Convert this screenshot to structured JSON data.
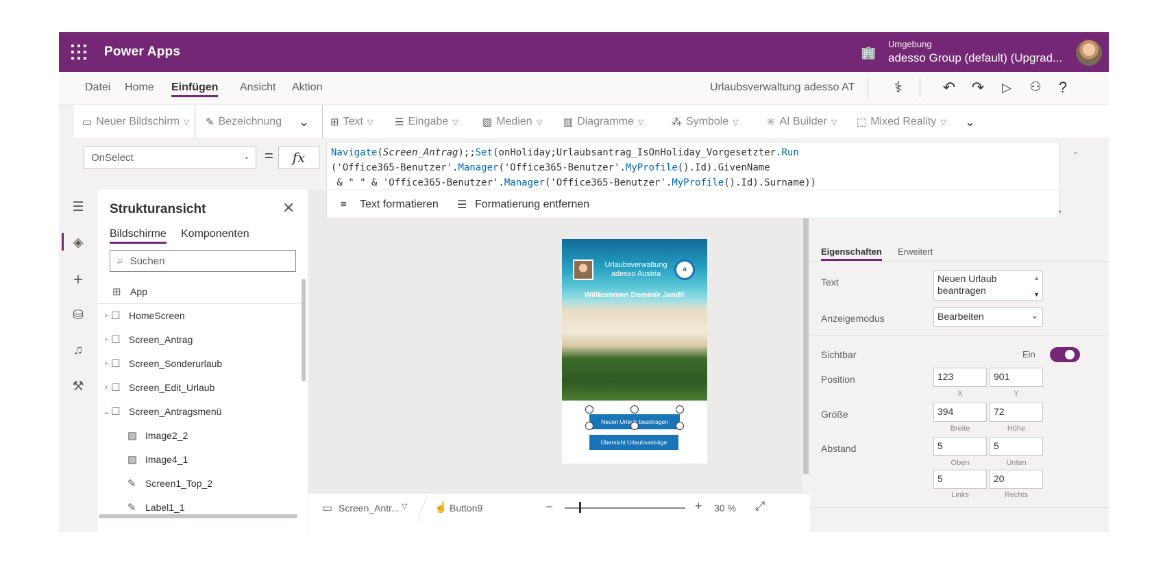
{
  "topbar": {
    "brand": "Power Apps",
    "env_label": "Umgebung",
    "env_name": "adesso Group (default) (Upgrad..."
  },
  "menu": {
    "items": [
      "Datei",
      "Home",
      "Einfügen",
      "Ansicht",
      "Aktion"
    ],
    "active": "Einfügen",
    "app_name": "Urlaubsverwaltung adesso AT"
  },
  "ribbon": {
    "new_screen": "Neuer Bildschirm",
    "label": "Bezeichnung",
    "text": "Text",
    "input": "Eingabe",
    "media": "Medien",
    "charts": "Diagramme",
    "icons": "Symbole",
    "ai_builder": "AI Builder",
    "mixed_reality": "Mixed Reality"
  },
  "formula_bar": {
    "property": "OnSelect",
    "equals": "=",
    "fx": "fx",
    "format_text": "Text formatieren",
    "remove_formatting": "Formatierung entfernen"
  },
  "tree": {
    "title": "Strukturansicht",
    "tabs": [
      "Bildschirme",
      "Komponenten"
    ],
    "search_placeholder": "Suchen",
    "items": [
      {
        "label": "App"
      },
      {
        "label": "HomeScreen"
      },
      {
        "label": "Screen_Antrag"
      },
      {
        "label": "Screen_Sonderurlaub"
      },
      {
        "label": "Screen_Edit_Urlaub"
      },
      {
        "label": "Screen_Antragsmenü"
      },
      {
        "label": "Image2_2"
      },
      {
        "label": "Image4_1"
      },
      {
        "label": "Screen1_Top_2"
      },
      {
        "label": "Label1_1"
      }
    ]
  },
  "canvas": {
    "app_title": "Urlaubsverwaltung adesso Austria",
    "logo": "a",
    "welcome": "Willkommen Dominik Jandl!",
    "button_new": "Neuen Urlaub beantragen",
    "button_overview": "Übersicht Urlaubsanträge"
  },
  "status": {
    "screen": "Screen_Antr...",
    "control": "Button9",
    "zoom": "30 %",
    "zoom_fraction": 0.12
  },
  "properties": {
    "tabs": [
      "Eigenschaften",
      "Erweitert"
    ],
    "text_label": "Text",
    "text_value_1": "Neuen Urlaub",
    "text_value_2": "beantragen",
    "display_mode_label": "Anzeigemodus",
    "display_mode_value": "Bearbeiten",
    "visible_label": "Sichtbar",
    "visible_value": "Ein",
    "position_label": "Position",
    "x": "123",
    "y": "901",
    "x_label": "X",
    "y_label": "Y",
    "size_label": "Größe",
    "width": "394",
    "height": "72",
    "width_label": "Breite",
    "height_label": "Höhe",
    "padding_label": "Abstand",
    "top": "5",
    "bottom": "5",
    "top_label": "Oben",
    "bottom_label": "Unten",
    "left": "5",
    "right": "20",
    "left_label": "Links",
    "right_label": "Rechts"
  },
  "colors": {
    "brand": "#742774",
    "button": "#1a74b8",
    "code_fn": "#0066b8"
  }
}
